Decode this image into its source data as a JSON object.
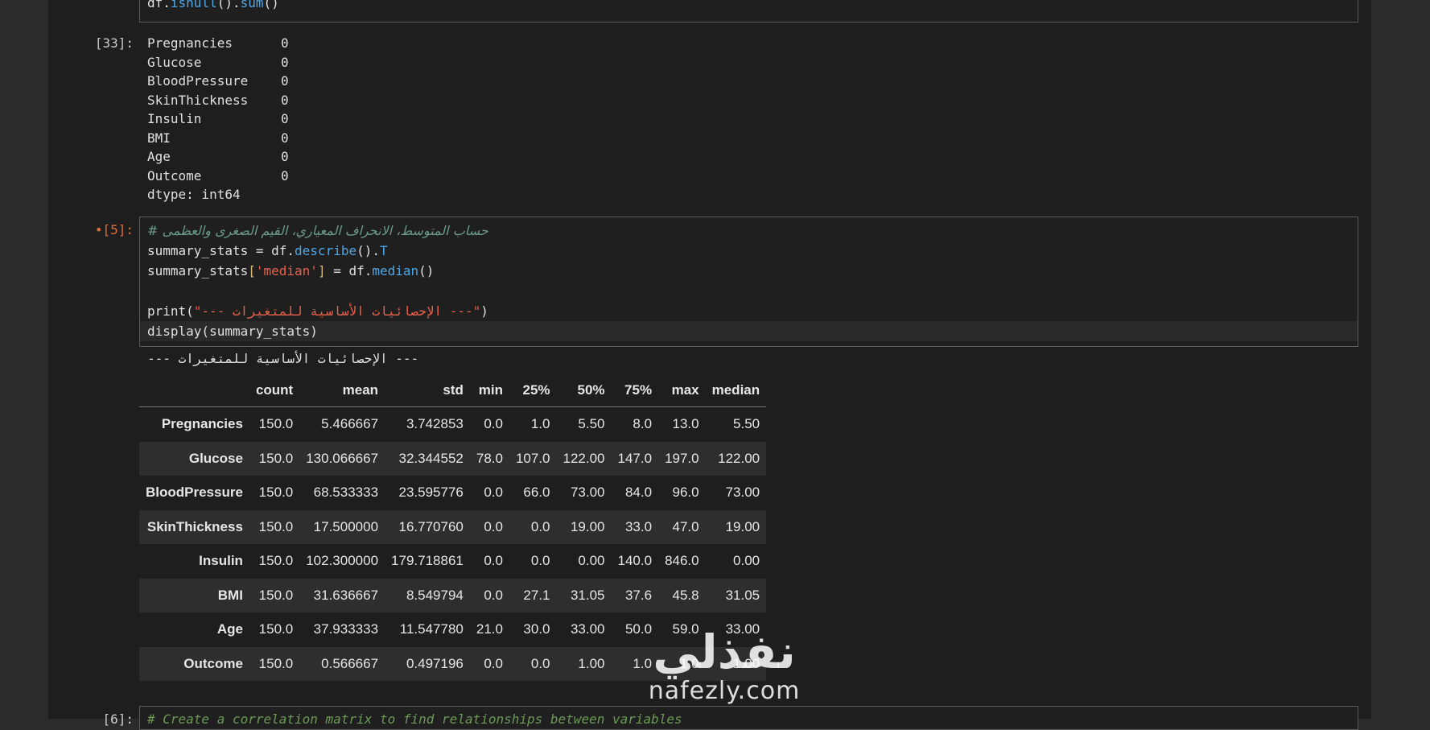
{
  "cell_top": {
    "code_parts": [
      "df.",
      "isnull",
      "().",
      "sum",
      "()"
    ]
  },
  "cell33": {
    "prompt": "[33]:",
    "output_rows": [
      {
        "name": "Pregnancies",
        "value": "0"
      },
      {
        "name": "Glucose",
        "value": "0"
      },
      {
        "name": "BloodPressure",
        "value": "0"
      },
      {
        "name": "SkinThickness",
        "value": "0"
      },
      {
        "name": "Insulin",
        "value": "0"
      },
      {
        "name": "BMI",
        "value": "0"
      },
      {
        "name": "Age",
        "value": "0"
      },
      {
        "name": "Outcome",
        "value": "0"
      }
    ],
    "dtype_line": "dtype: int64"
  },
  "cell5": {
    "prompt": "•[5]:",
    "comment": "# حساب المتوسط، الانحراف المعياري، القيم الصغرى والعظمى",
    "line2": {
      "a": "summary_stats = df.",
      "fn": "describe",
      "b": "().",
      "attr": "T"
    },
    "line3": {
      "a": "summary_stats",
      "b1": "[",
      "str": "'median'",
      "b2": "]",
      "c": " = df.",
      "fn": "median",
      "d": "()"
    },
    "line5": {
      "a": "print(",
      "str": "\"--- الإحصائيات الأساسية للمتغيرات ---\"",
      "b": ")"
    },
    "line6": "display(summary_stats)",
    "print_output": "--- الإحصائيات الأساسية للمتغيرات ---"
  },
  "table": {
    "columns": [
      "",
      "count",
      "mean",
      "std",
      "min",
      "25%",
      "50%",
      "75%",
      "max",
      "median"
    ],
    "rows": [
      [
        "Pregnancies",
        "150.0",
        "5.466667",
        "3.742853",
        "0.0",
        "1.0",
        "5.50",
        "8.0",
        "13.0",
        "5.50"
      ],
      [
        "Glucose",
        "150.0",
        "130.066667",
        "32.344552",
        "78.0",
        "107.0",
        "122.00",
        "147.0",
        "197.0",
        "122.00"
      ],
      [
        "BloodPressure",
        "150.0",
        "68.533333",
        "23.595776",
        "0.0",
        "66.0",
        "73.00",
        "84.0",
        "96.0",
        "73.00"
      ],
      [
        "SkinThickness",
        "150.0",
        "17.500000",
        "16.770760",
        "0.0",
        "0.0",
        "19.00",
        "33.0",
        "47.0",
        "19.00"
      ],
      [
        "Insulin",
        "150.0",
        "102.300000",
        "179.718861",
        "0.0",
        "0.0",
        "0.00",
        "140.0",
        "846.0",
        "0.00"
      ],
      [
        "BMI",
        "150.0",
        "31.636667",
        "8.549794",
        "0.0",
        "27.1",
        "31.05",
        "37.6",
        "45.8",
        "31.05"
      ],
      [
        "Age",
        "150.0",
        "37.933333",
        "11.547780",
        "21.0",
        "30.0",
        "33.00",
        "50.0",
        "59.0",
        "33.00"
      ],
      [
        "Outcome",
        "150.0",
        "0.566667",
        "0.497196",
        "0.0",
        "0.0",
        "1.00",
        "1.0",
        "1.0",
        "1.00"
      ]
    ]
  },
  "cell_next": {
    "prompt": "[6]:",
    "comment": "# Create a correlation matrix to find relationships between variables"
  },
  "watermark": {
    "arabic": "نفذلي",
    "latin": "nafezly.com"
  }
}
